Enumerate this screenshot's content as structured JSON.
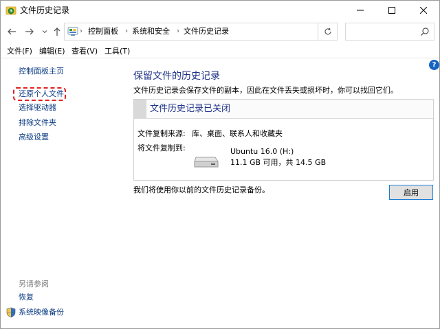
{
  "window": {
    "title": "文件历史记录",
    "controls": {
      "minimize": "—",
      "maximize": "☐",
      "close": "✕"
    }
  },
  "nav": {
    "back": "←",
    "forward": "→",
    "recent": "⌄",
    "up": "↑",
    "breadcrumb": [
      "控制面板",
      "系统和安全",
      "文件历史记录"
    ],
    "separator": "›",
    "refresh": "↻",
    "search_placeholder": ""
  },
  "menu": [
    "文件(F)",
    "编辑(E)",
    "查看(V)",
    "工具(T)"
  ],
  "sidebar": {
    "items": [
      {
        "label": "控制面板主页"
      },
      {
        "label": "还原个人文件"
      },
      {
        "label": "选择驱动器"
      },
      {
        "label": "排除文件夹"
      },
      {
        "label": "高级设置"
      }
    ],
    "see_also_title": "另请参阅",
    "see_also": [
      {
        "label": "恢复"
      },
      {
        "label": "系统映像备份"
      }
    ]
  },
  "main": {
    "title": "保留文件的历史记录",
    "description": "文件历史记录会保存文件的副本，因此在文件丢失或损坏时，你可以找回它们。",
    "status_title": "文件历史记录已关闭",
    "copy_from_label": "文件复制来源:",
    "copy_from_value": "库、桌面、联系人和收藏夹",
    "copy_to_label": "将文件复制到:",
    "drive_name": "Ubuntu 16.0 (H:)",
    "drive_size": "11.1 GB 可用，共 14.5 GB",
    "footer_note": "我们将使用你以前的文件历史记录备份。",
    "enable_label": "启用",
    "help": "?"
  },
  "colors": {
    "link": "#0a3a82",
    "heading": "#1e3287",
    "highlight": "#e02020",
    "button_border": "#1c7ed6"
  }
}
